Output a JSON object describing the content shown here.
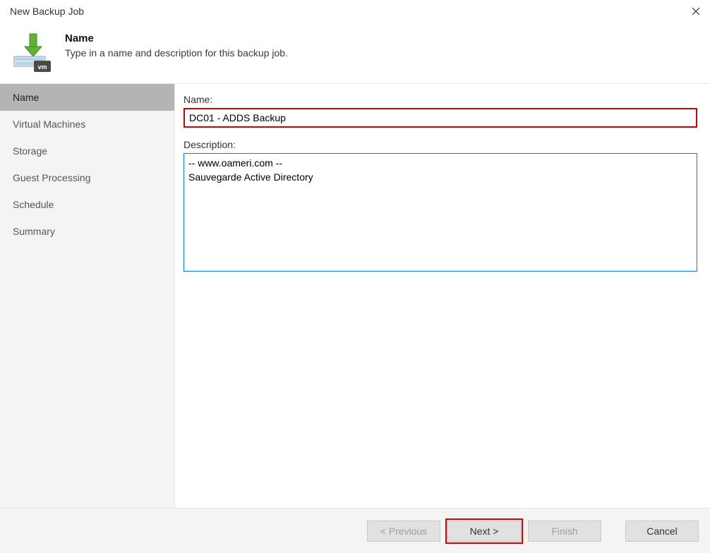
{
  "window": {
    "title": "New Backup Job"
  },
  "header": {
    "title": "Name",
    "subtitle": "Type in a name and description for this backup job."
  },
  "sidebar": {
    "items": [
      {
        "label": "Name"
      },
      {
        "label": "Virtual Machines"
      },
      {
        "label": "Storage"
      },
      {
        "label": "Guest Processing"
      },
      {
        "label": "Schedule"
      },
      {
        "label": "Summary"
      }
    ],
    "active_index": 0
  },
  "form": {
    "name_label": "Name:",
    "name_value": "DC01 - ADDS Backup",
    "description_label": "Description:",
    "description_value": "-- www.oameri.com --\nSauvegarde Active Directory"
  },
  "footer": {
    "previous_label": "< Previous",
    "next_label": "Next >",
    "finish_label": "Finish",
    "cancel_label": "Cancel"
  }
}
